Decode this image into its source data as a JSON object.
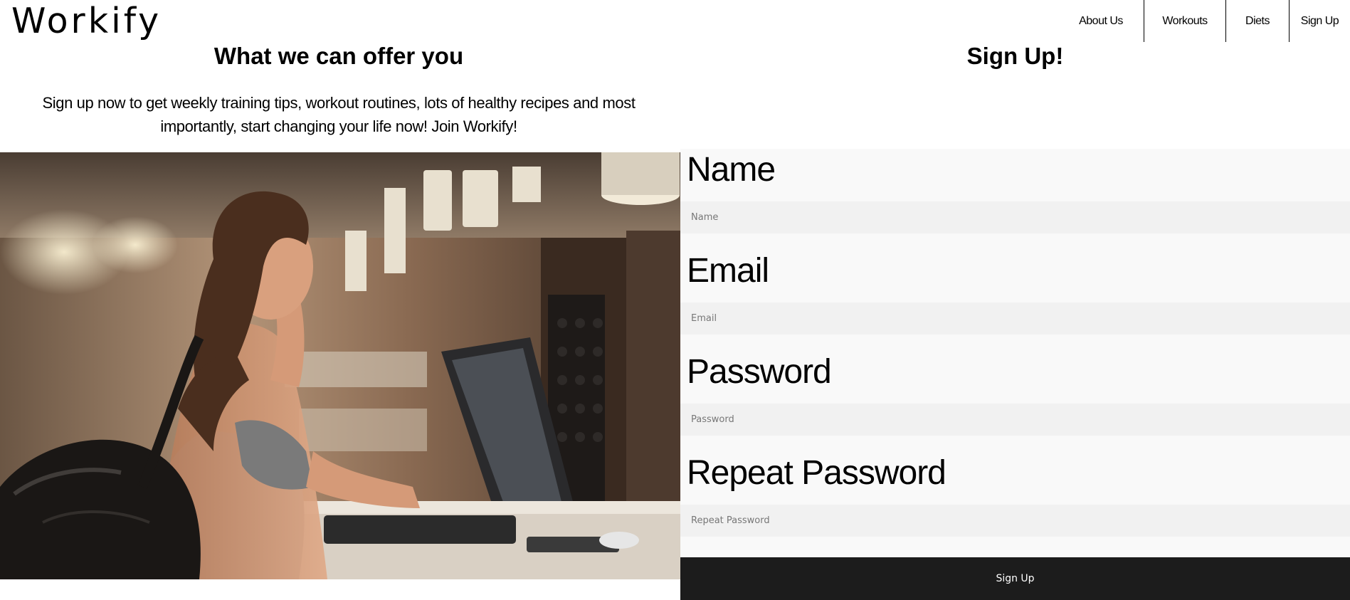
{
  "header": {
    "logo": "Workify",
    "nav": {
      "about": "About Us",
      "workouts": "Workouts",
      "diets": "Diets",
      "signup": "Sign Up"
    }
  },
  "offer": {
    "title": "What we can offer you",
    "description": "Sign up now to get weekly training tips, workout routines, lots of healthy recipes and most importantly, start changing your life now! Join Workify!"
  },
  "signup": {
    "title": "Sign Up!",
    "fields": [
      {
        "label": "Name",
        "placeholder": "Name",
        "value": ""
      },
      {
        "label": "Email",
        "placeholder": "Email",
        "value": ""
      },
      {
        "label": "Password",
        "placeholder": "Password",
        "value": ""
      },
      {
        "label": "Repeat Password",
        "placeholder": "Repeat Password",
        "value": ""
      }
    ],
    "submit_label": "Sign Up"
  },
  "colors": {
    "submit_bg": "#1c1c1c",
    "form_bg": "#f9f9f9",
    "input_bg": "#f1f1f1"
  }
}
